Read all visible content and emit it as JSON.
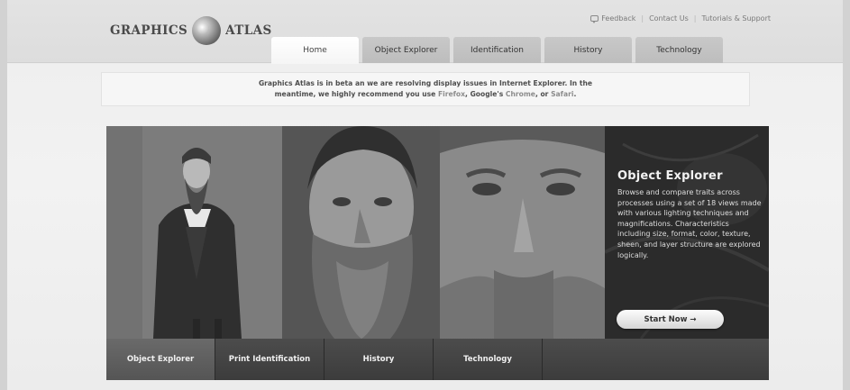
{
  "logo": {
    "left_text": "GRAPHICS",
    "right_text": "ATLAS",
    "mark": "globe-logo"
  },
  "util_nav": {
    "feedback": "Feedback",
    "contact": "Contact Us",
    "tutorials": "Tutorials & Support",
    "feedback_icon": "speech-bubble-icon"
  },
  "tabs": [
    {
      "label": "Home",
      "active": true
    },
    {
      "label": "Object Explorer",
      "active": false
    },
    {
      "label": "Identification",
      "active": false
    },
    {
      "label": "History",
      "active": false
    },
    {
      "label": "Technology",
      "active": false
    }
  ],
  "notice": {
    "line1": "Graphics Atlas is in beta an we are resolving display issues in Internet Explorer. In the",
    "line2_pre": "meantime, we highly recommend you use ",
    "firefox": "Firefox",
    "sep1": ", Google's ",
    "chrome": "Chrome",
    "sep2": ", or ",
    "safari": "Safari",
    "end": "."
  },
  "hero": {
    "title": "Object Explorer",
    "body": "Browse and compare traits across processes using a set of 18 views made with various lighting techniques and magnifications. Characteristics including size, format, color, texture, sheen, and layer structure are explored logically.",
    "button": "Start Now →"
  },
  "hero_nav": [
    {
      "label": "Object Explorer",
      "active": true
    },
    {
      "label": "Print Identification",
      "active": false
    },
    {
      "label": "History",
      "active": false
    },
    {
      "label": "Technology",
      "active": false
    }
  ],
  "colors": {
    "accent": "#8c8c8c",
    "hero_bg": "#2a2a2a",
    "nav_active": "#5e5e5e"
  }
}
